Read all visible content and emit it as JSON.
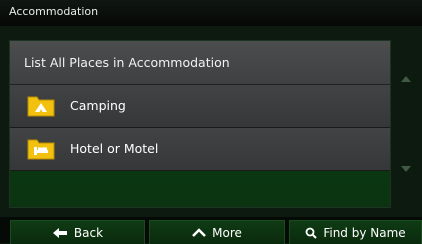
{
  "header": {
    "title": "Accommodation"
  },
  "list": {
    "heading": "List All Places in Accommodation",
    "items": [
      {
        "label": "Camping",
        "icon": "camping-tent-icon"
      },
      {
        "label": "Hotel or Motel",
        "icon": "hotel-bed-icon"
      }
    ]
  },
  "toolbar": {
    "back_label": "Back",
    "more_label": "More",
    "find_label": "Find by Name"
  },
  "colors": {
    "folder_yellow": "#f2c10f",
    "button_green": "#0f3b14",
    "background": "#0c1a10"
  }
}
